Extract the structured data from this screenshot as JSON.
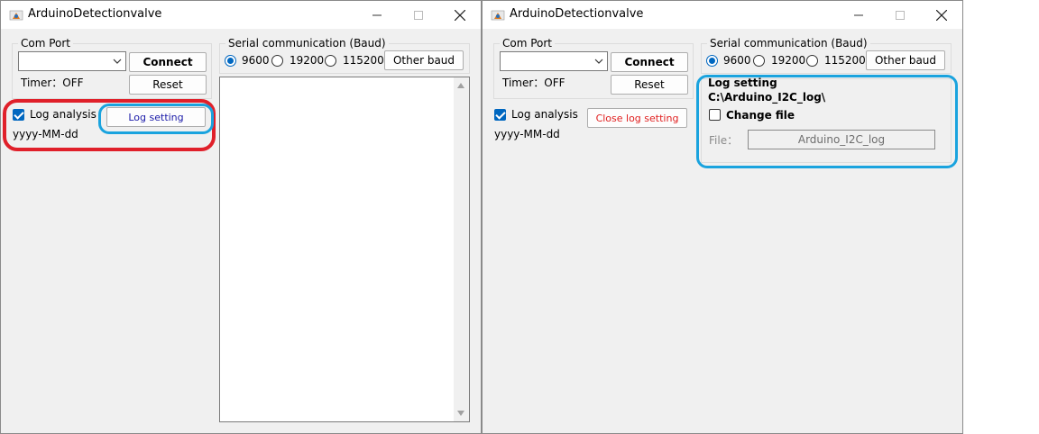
{
  "window_left": {
    "title": "ArduinoDetectionvalve",
    "com_port": {
      "group_label": "Com Port",
      "selected_port": "",
      "connect_label": "Connect",
      "timer_text": "Timer：OFF",
      "reset_label": "Reset"
    },
    "log": {
      "checkbox_label": "Log analysis",
      "checked": true,
      "button_label": "Log setting",
      "date_format": "yyyy-MM-dd"
    },
    "serial": {
      "group_label": "Serial communication (Baud)",
      "baud_options": [
        "9600",
        "19200",
        "115200"
      ],
      "selected_baud": "9600",
      "other_baud_label": "Other baud",
      "output_text": ""
    }
  },
  "window_right": {
    "title": "ArduinoDetectionvalve",
    "com_port": {
      "group_label": "Com Port",
      "selected_port": "",
      "connect_label": "Connect",
      "timer_text": "Timer：OFF",
      "reset_label": "Reset"
    },
    "log": {
      "checkbox_label": "Log analysis",
      "checked": true,
      "button_label": "Close log setting",
      "date_format": "yyyy-MM-dd"
    },
    "serial": {
      "group_label": "Serial communication (Baud)",
      "baud_options": [
        "9600",
        "19200",
        "115200"
      ],
      "selected_baud": "9600",
      "other_baud_label": "Other baud"
    },
    "log_setting": {
      "title": "Log setting",
      "path": "C:\\Arduino_I2C_log\\",
      "change_file_label": "Change file",
      "change_file_checked": false,
      "file_label": "File：",
      "file_value": "Arduino_I2C_log"
    }
  },
  "colors": {
    "window_bg": "#f0f0f0",
    "accent_blue": "#0067c0",
    "log_button_text": "#1a1aa8",
    "close_log_text": "#e01e1e",
    "highlight_red": "#e0202a",
    "highlight_blue": "#1aa3de"
  }
}
